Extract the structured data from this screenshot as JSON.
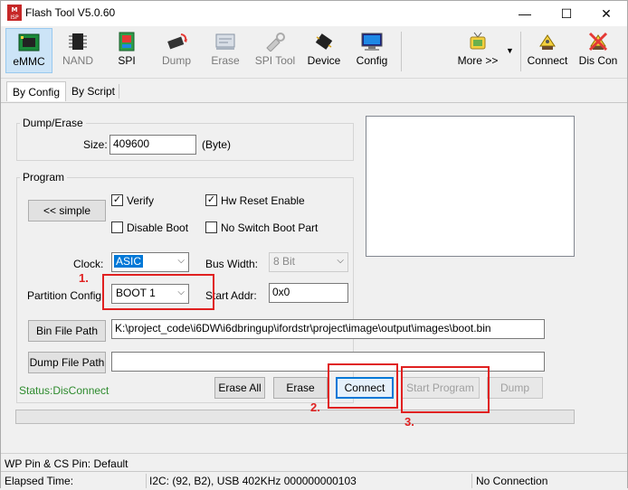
{
  "window": {
    "title": "Flash Tool V5.0.60",
    "minimize": "—",
    "maximize": "☐",
    "close": "✕"
  },
  "toolbar": {
    "emmc": "eMMC",
    "nand": "NAND",
    "spi": "SPI",
    "dump": "Dump",
    "erase": "Erase",
    "spi_tool": "SPI Tool",
    "device": "Device",
    "config": "Config",
    "more": "More >>",
    "connect": "Connect",
    "disconnect": "Dis Con"
  },
  "tabs": {
    "by_config": "By Config",
    "by_script": "By Script"
  },
  "dump_erase": {
    "group_title": "Dump/Erase",
    "size_label": "Size:",
    "size_value": "409600",
    "size_unit": "(Byte)"
  },
  "program": {
    "group_title": "Program",
    "simple_button": "<< simple",
    "verify": {
      "label": "Verify",
      "checked": true
    },
    "hw_reset": {
      "label": "Hw Reset Enable",
      "checked": true
    },
    "disable_boot": {
      "label": "Disable Boot",
      "checked": false
    },
    "no_switch_boot": {
      "label": "No Switch Boot Part",
      "checked": false
    },
    "clock_label": "Clock:",
    "clock_value": "ASIC",
    "bus_width_label": "Bus Width:",
    "bus_width_value": "8 Bit",
    "partition_label": "Partition Config:",
    "partition_value": "BOOT 1",
    "start_addr_label": "Start Addr:",
    "start_addr_value": "0x0",
    "bin_file_button": "Bin File Path",
    "bin_file_value": "K:\\project_code\\i6DW\\i6dbringup\\ifordstr\\project\\image\\output\\images\\boot.bin",
    "dump_file_button": "Dump File Path",
    "dump_file_value": ""
  },
  "actions": {
    "erase_all": "Erase All",
    "erase": "Erase",
    "connect": "Connect",
    "start_program": "Start Program",
    "dump": "Dump"
  },
  "status_text": "Status:DisConnect",
  "annotations": {
    "step1": "1.",
    "step2": "2.",
    "step3": "3."
  },
  "statusbar": {
    "pin_info": "WP Pin & CS Pin: Default",
    "elapsed": "Elapsed Time:",
    "i2c": "I2C: (92, B2), USB  402KHz  000000000103",
    "connection": "No Connection"
  },
  "colors": {
    "accent": "#0078d7",
    "status_green": "#2e8b2e",
    "annotation_red": "#e02020"
  }
}
